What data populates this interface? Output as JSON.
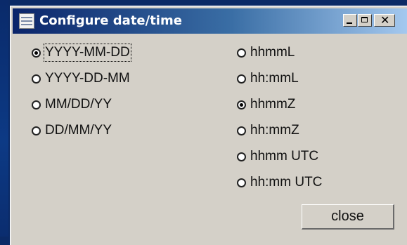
{
  "window": {
    "title": "Configure date/time"
  },
  "date_formats": [
    {
      "label": "YYYY-MM-DD",
      "checked": true
    },
    {
      "label": "YYYY-DD-MM",
      "checked": false
    },
    {
      "label": "MM/DD/YY",
      "checked": false
    },
    {
      "label": "DD/MM/YY",
      "checked": false
    }
  ],
  "time_formats": [
    {
      "label": "hhmmL",
      "checked": false
    },
    {
      "label": "hh:mmL",
      "checked": false
    },
    {
      "label": "hhmmZ",
      "checked": true
    },
    {
      "label": "hh:mmZ",
      "checked": false
    },
    {
      "label": "hhmm UTC",
      "checked": false
    },
    {
      "label": "hh:mm UTC",
      "checked": false
    }
  ],
  "buttons": {
    "close_label": "close"
  },
  "colors": {
    "title_bar_start": "#0a246a",
    "title_bar_end": "#a6caf0",
    "dialog_bg": "#d4d0c8",
    "desktop": "#0b2a66"
  }
}
